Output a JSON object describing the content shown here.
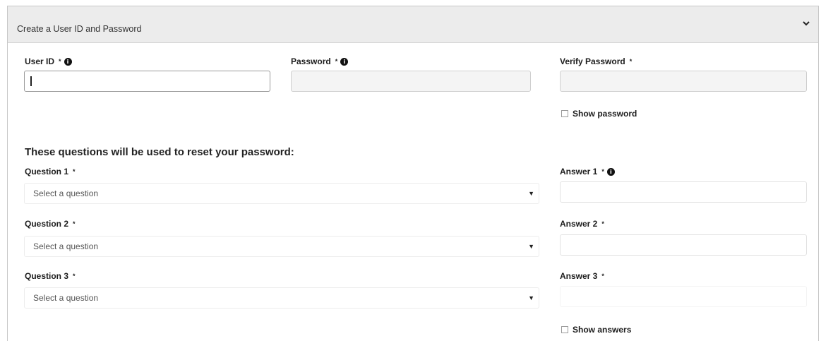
{
  "panel": {
    "title": "Create a User ID and Password",
    "collapse_icon": "chevron-down-icon"
  },
  "credentials": {
    "user_id_label": "User ID",
    "user_id_value": "",
    "password_label": "Password",
    "password_value": "",
    "verify_label": "Verify Password",
    "verify_value": "",
    "show_password_label": "Show password",
    "required_marker": "*",
    "info_icon": "i"
  },
  "security": {
    "heading": "These questions will be used to reset your password:",
    "questions": [
      {
        "label": "Question 1",
        "selected": "Select a question"
      },
      {
        "label": "Question 2",
        "selected": "Select a question"
      },
      {
        "label": "Question 3",
        "selected": "Select a question"
      }
    ],
    "answers": [
      {
        "label": "Answer 1"
      },
      {
        "label": "Answer 2"
      },
      {
        "label": "Answer 3"
      }
    ],
    "show_answers_label": "Show answers",
    "dropdown_arrow": "▼"
  }
}
